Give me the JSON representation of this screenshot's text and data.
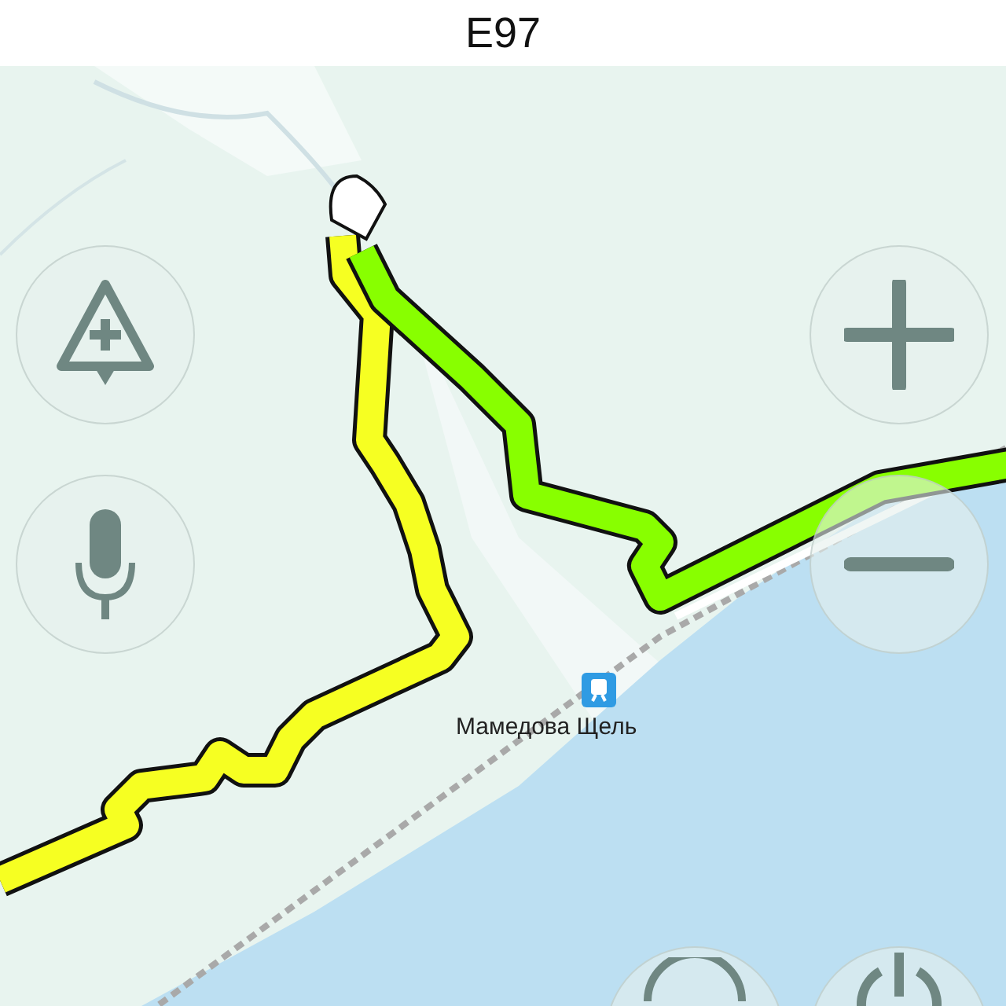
{
  "header": {
    "title": "E97"
  },
  "map": {
    "kind": "picture",
    "labels": [
      {
        "text": "Мамедова Щель",
        "kind": "station"
      }
    ]
  },
  "left_controls": [
    {
      "kind": "hazard"
    },
    {
      "kind": "mic"
    }
  ],
  "right_controls": [
    {
      "kind": "zoom-in"
    },
    {
      "kind": "zoom-out"
    }
  ],
  "bottom_controls": [
    {
      "kind": "plain"
    },
    {
      "kind": "compass"
    }
  ]
}
